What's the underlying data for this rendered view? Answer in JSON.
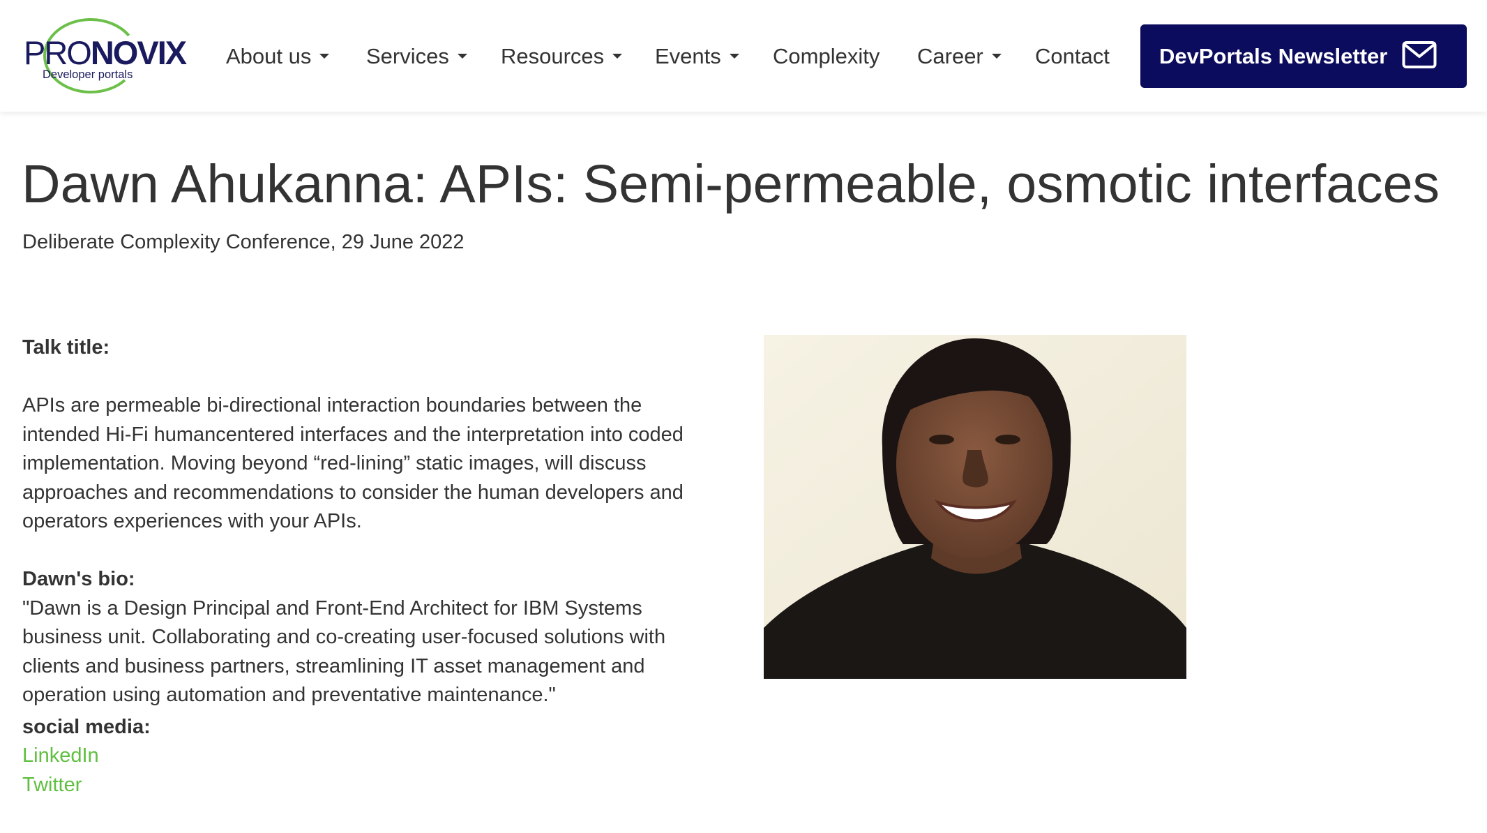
{
  "logo": {
    "pro": "PRO",
    "novix": "NOVIX",
    "tagline": "Developer portals"
  },
  "nav": {
    "items": [
      {
        "label": "About us",
        "has_dropdown": true
      },
      {
        "label": "Services",
        "has_dropdown": true
      },
      {
        "label": "Resources",
        "has_dropdown": true
      },
      {
        "label": "Events",
        "has_dropdown": true
      },
      {
        "label": "Complexity",
        "has_dropdown": false
      },
      {
        "label": "Career",
        "has_dropdown": true
      },
      {
        "label": "Contact",
        "has_dropdown": false
      }
    ],
    "newsletter_label": "DevPortals Newsletter",
    "newsletter_icon": "envelope-icon"
  },
  "page": {
    "title": "Dawn Ahukanna: APIs: Semi-permeable, osmotic interfaces",
    "subtitle": "Deliberate Complexity Conference, 29 June 2022"
  },
  "talk": {
    "label": "Talk title:",
    "text_lines": [
      "APIs are permeable bi-directional interaction boundaries between the",
      "intended Hi-Fi humancentered interfaces and the interpretation into coded",
      "implementation. Moving beyond “red-lining” static images, will discuss",
      "approaches and recommendations to consider the human developers and",
      "operators experiences with your APIs."
    ]
  },
  "bio": {
    "label": "Dawn's bio:",
    "text_lines": [
      "\"Dawn is a Design Principal and Front-End Architect for IBM Systems",
      "business unit. Collaborating and co-creating user-focused solutions with",
      "clients and business partners, streamlining IT asset management and",
      "operation using automation and preventative maintenance.\""
    ]
  },
  "social": {
    "label": "social media:",
    "links": [
      "LinkedIn",
      "Twitter"
    ]
  },
  "colors": {
    "brand_navy": "#0c0c5e",
    "logo_green": "#6cc04a",
    "link_green": "#5fbf3f",
    "text": "#333333"
  }
}
